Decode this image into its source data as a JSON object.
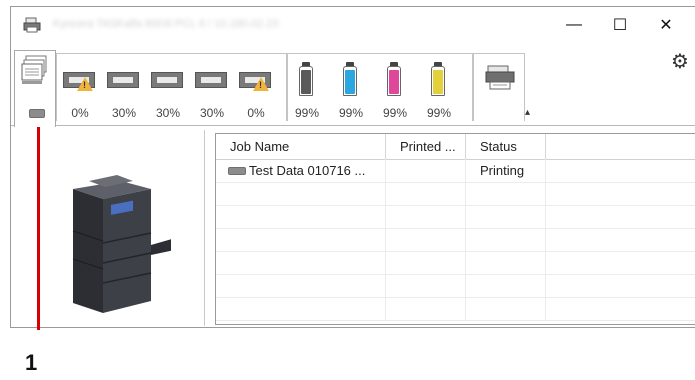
{
  "window": {
    "title": "Kyocera TASKalfa 8003i PCL 6 / 10.180.02.23",
    "controls": {
      "minimize": "—",
      "maximize": "☐",
      "close": "✕"
    },
    "icons": {
      "app": "printer-app-icon",
      "settings": "gear-icon",
      "collapse": "chevron-up-icon"
    }
  },
  "toolbar": {
    "jobs_tab_icon": "job-list-icon",
    "paper_trays": [
      {
        "icon": "tray-icon",
        "warning": true,
        "level": "0%"
      },
      {
        "icon": "tray-icon",
        "warning": false,
        "level": "30%"
      },
      {
        "icon": "tray-icon",
        "warning": false,
        "level": "30%"
      },
      {
        "icon": "tray-icon",
        "warning": false,
        "level": "30%"
      },
      {
        "icon": "tray-icon",
        "warning": true,
        "level": "0%"
      }
    ],
    "toners": [
      {
        "icon": "toner-black-icon",
        "color": "#5a5a5a",
        "level": "99%"
      },
      {
        "icon": "toner-cyan-icon",
        "color": "#2aa7e0",
        "level": "99%"
      },
      {
        "icon": "toner-magenta-icon",
        "color": "#e0479a",
        "level": "99%"
      },
      {
        "icon": "toner-yellow-icon",
        "color": "#e4d13a",
        "level": "99%"
      }
    ],
    "scanner_icon": "scanner-icon"
  },
  "job_table": {
    "columns": [
      "Job Name",
      "Printed ...",
      "Status"
    ],
    "rows": [
      {
        "name": "Test Data 010716 ...",
        "printed": "",
        "status": "Printing"
      }
    ]
  },
  "callout": {
    "number": "1",
    "color": "#d80000"
  }
}
